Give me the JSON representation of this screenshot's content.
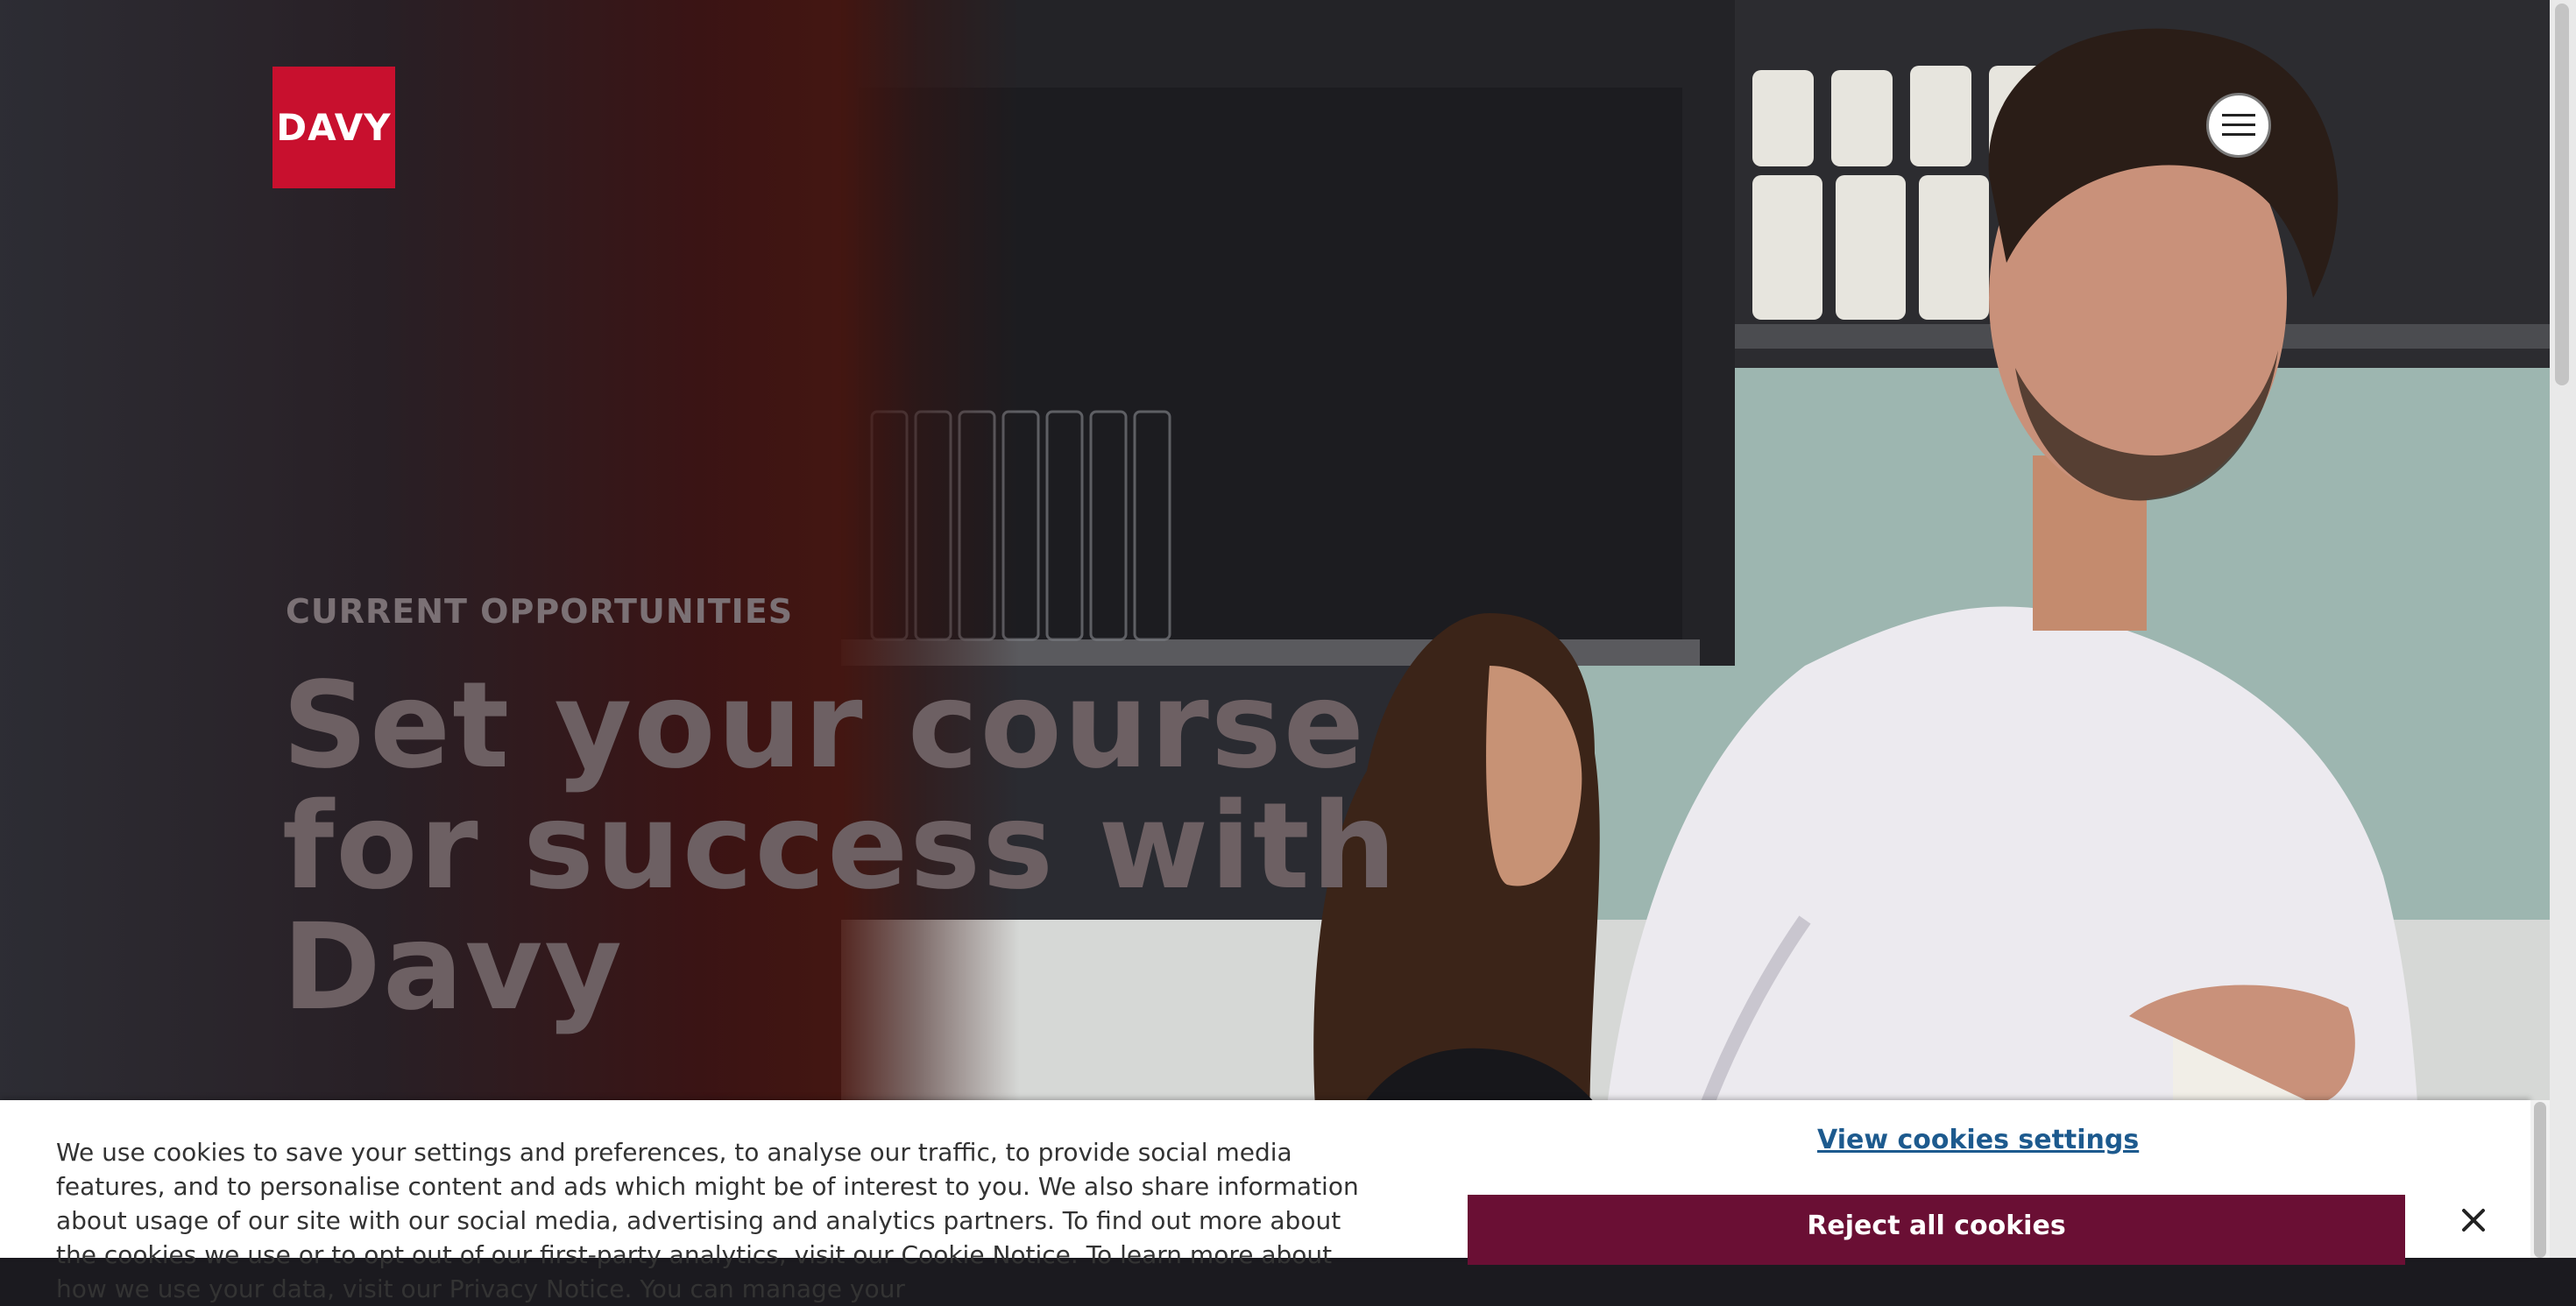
{
  "brand": {
    "logo_text": "DAVY",
    "logo_color": "#c8102e"
  },
  "header": {
    "menu_icon": "hamburger-icon"
  },
  "hero": {
    "eyebrow": "CURRENT OPPORTUNITIES",
    "headline": "Set your course for success with Davy"
  },
  "cookie_banner": {
    "text": "We use cookies to save your settings and preferences, to analyse our traffic, to provide social media features, and to personalise content and ads which might be of interest to you. We also share information about usage of our site with our social media, advertising and analytics partners. To find out more about the cookies we use or to opt out of our first-party analytics, visit our Cookie Notice. To learn more about how we use your data, visit our Privacy Notice. You can manage your",
    "view_settings_label": "View cookies settings",
    "reject_label": "Reject all cookies",
    "close_icon": "close-icon",
    "reject_color": "#6a0f34",
    "link_color": "#1d5a8e"
  }
}
